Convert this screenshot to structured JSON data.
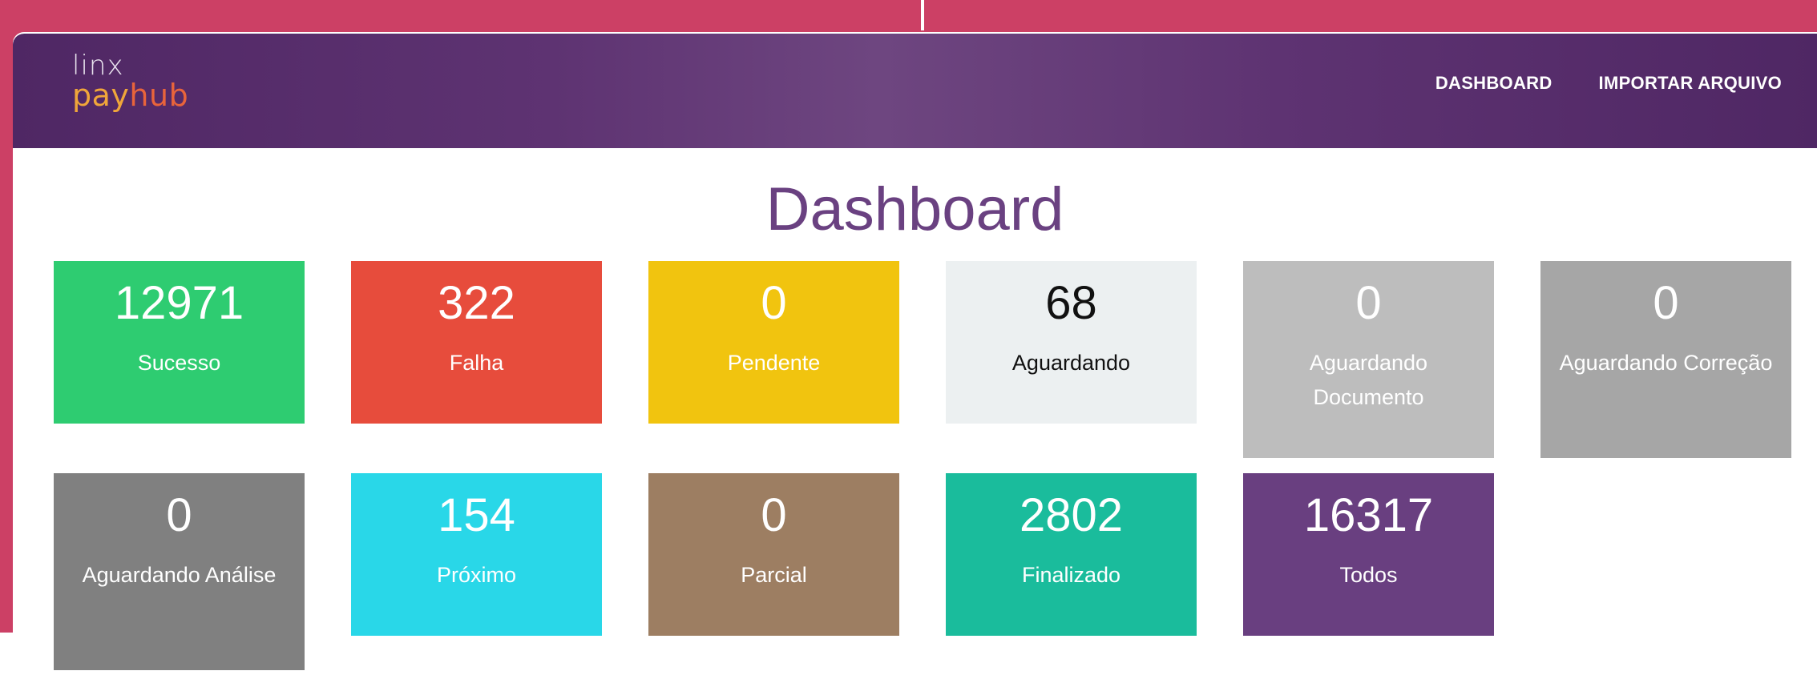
{
  "app": {
    "logo_line1": "linx",
    "logo_line2_a": "pay",
    "logo_line2_b": "hub",
    "colors": {
      "navbar": "#5a2f6e",
      "background": "#cc4065",
      "title": "#6a4181"
    }
  },
  "nav": {
    "items": [
      {
        "label": "DASHBOARD"
      },
      {
        "label": "IMPORTAR ARQUIVO"
      }
    ]
  },
  "main": {
    "title": "Dashboard",
    "tiles": [
      {
        "count": "12971",
        "label": "Sucesso",
        "color": "#2ecc71"
      },
      {
        "count": "322",
        "label": "Falha",
        "color": "#e74c3c"
      },
      {
        "count": "0",
        "label": "Pendente",
        "color": "#f1c40f"
      },
      {
        "count": "68",
        "label": "Aguardando",
        "color": "#ecf0f1"
      },
      {
        "count": "0",
        "label": "Aguardando Documento",
        "color": "#bdbdbd"
      },
      {
        "count": "0",
        "label": "Aguardando Correção",
        "color": "#a6a6a6"
      },
      {
        "count": "0",
        "label": "Aguardando Análise",
        "color": "#808080"
      },
      {
        "count": "154",
        "label": "Próximo",
        "color": "#29d7e8"
      },
      {
        "count": "0",
        "label": "Parcial",
        "color": "#9d7e62"
      },
      {
        "count": "2802",
        "label": "Finalizado",
        "color": "#1abc9c"
      },
      {
        "count": "16317",
        "label": "Todos",
        "color": "#693f80"
      }
    ]
  }
}
